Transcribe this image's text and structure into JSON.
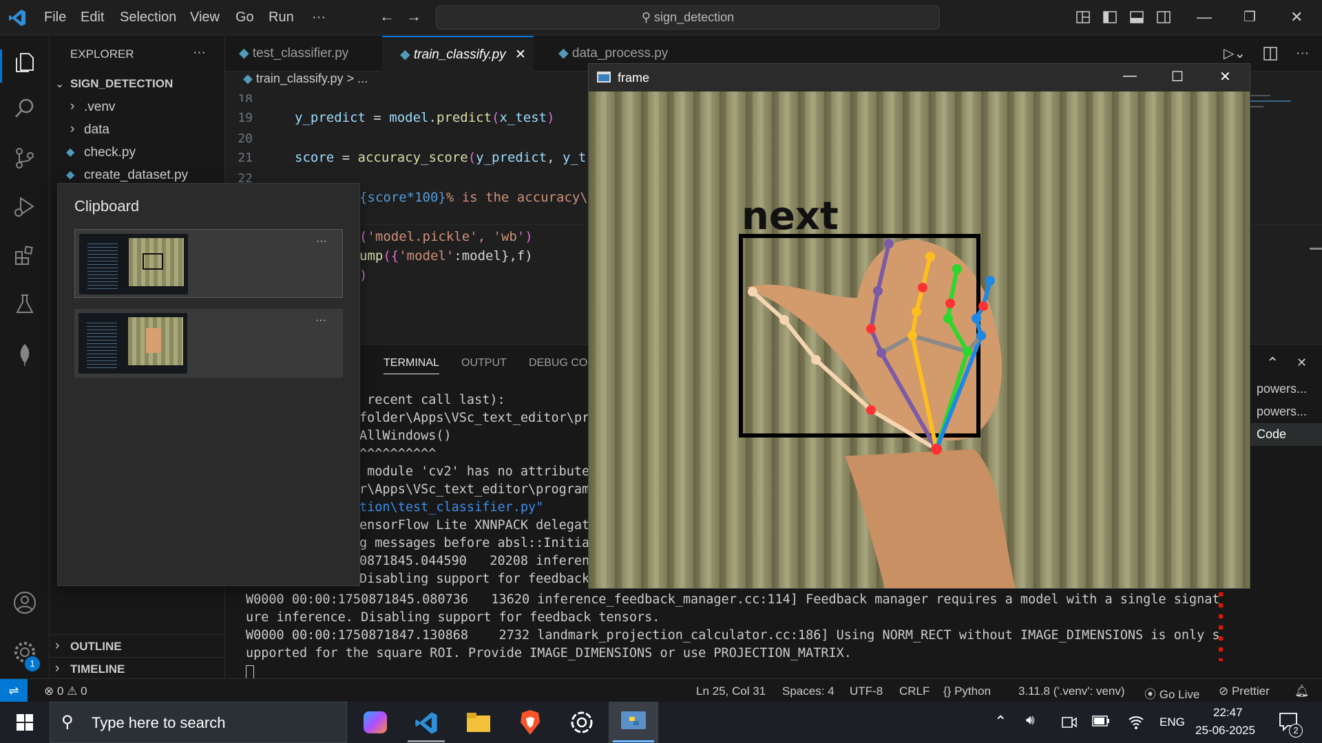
{
  "menu": {
    "file": "File",
    "edit": "Edit",
    "selection": "Selection",
    "view": "View",
    "go": "Go",
    "run": "Run",
    "more": "···"
  },
  "command_center": {
    "text": "sign_detection"
  },
  "explorer": {
    "title": "EXPLORER",
    "more": "···",
    "root": "SIGN_DETECTION",
    "items": [
      {
        "label": ".venv"
      },
      {
        "label": "data"
      },
      {
        "label": "check.py"
      },
      {
        "label": "create_dataset.py"
      }
    ],
    "outline": "OUTLINE",
    "timeline": "TIMELINE"
  },
  "tabs": [
    {
      "label": "test_classifier.py"
    },
    {
      "label": "train_classify.py"
    },
    {
      "label": "data_process.py"
    }
  ],
  "breadcrumb": {
    "file": "train_classify.py",
    "sep": ">",
    "rest": "..."
  },
  "code": {
    "line_numbers": [
      "18",
      "19",
      "20",
      "21",
      "22"
    ],
    "l19_a": "y_predict",
    "l19_b": " = ",
    "l19_c": "model",
    "l19_d": ".",
    "l19_e": "predict",
    "l19_f": "(",
    "l19_g": "x_test",
    "l19_h": ")",
    "l21_a": "score",
    "l21_b": " = ",
    "l21_c": "accuracy_score",
    "l21_d": "(",
    "l21_e": "y_predict",
    "l21_f": ", ",
    "l21_g": "y_t",
    "l23_a": "{score*100}",
    "l23_b": "% is the accuracy\\",
    "l24_a": "('",
    "l24_b": "model.pickle",
    "l24_c": "', '",
    "l24_d": "wb",
    "l24_e": "')",
    "l25_a": "ump",
    "l25_b": "({",
    "l25_c": "'model'",
    "l25_d": ":model},f)",
    "l26_a": ")"
  },
  "panel": {
    "tabs": [
      {
        "label": "TERMINAL"
      },
      {
        "label": "OUTPUT"
      },
      {
        "label": "DEBUG CON"
      }
    ],
    "terminals": [
      {
        "label": "powers..."
      },
      {
        "label": "powers..."
      },
      {
        "label": "Code"
      }
    ],
    "lines_partial": [
      " recent call last):",
      "folder\\Apps\\VSc_text_editor\\pr",
      "AllWindows()",
      "^^^^^^^^^^",
      " module 'cv2' has no attribute",
      "r\\Apps\\VSc_text_editor\\program",
      "tion\\test_classifier.py\"",
      "ensorFlow Lite XNNPACK delegat",
      "g messages before absl::Initia",
      "0871845.044590   20208 inferen",
      "Disabling support for feedback"
    ],
    "lines_full": [
      "W0000 00:00:1750871845.080736   13620 inference_feedback_manager.cc:114] Feedback manager requires a model with a single signat",
      "ure inference. Disabling support for feedback tensors.",
      "W0000 00:00:1750871847.130868    2732 landmark_projection_calculator.cc:186] Using NORM_RECT without IMAGE_DIMENSIONS is only s",
      "upported for the square ROI. Provide IMAGE_DIMENSIONS or use PROJECTION_MATRIX."
    ]
  },
  "clipboard": {
    "title": "Clipboard",
    "more": "···"
  },
  "frame": {
    "title": "frame",
    "label": "next"
  },
  "status": {
    "errors": "0",
    "warnings": "0",
    "position": "Ln 25, Col 31",
    "spaces": "Spaces: 4",
    "encoding": "UTF-8",
    "eol": "CRLF",
    "language": "Python",
    "interpreter": "3.11.8 ('.venv': venv)",
    "golive": "Go Live",
    "prettier": "Prettier",
    "accounts_badge": "1"
  },
  "taskbar": {
    "search_placeholder": "Type here to search",
    "lang": "ENG",
    "time": "22:47",
    "date": "25-06-2025",
    "notif": "2"
  },
  "colors": {
    "accent": "#0078d4",
    "python_blue": "#519aba",
    "variable": "#9cdcfe",
    "function": "#dcdcaa",
    "string": "#ce9178",
    "brace": "#da70d6"
  }
}
